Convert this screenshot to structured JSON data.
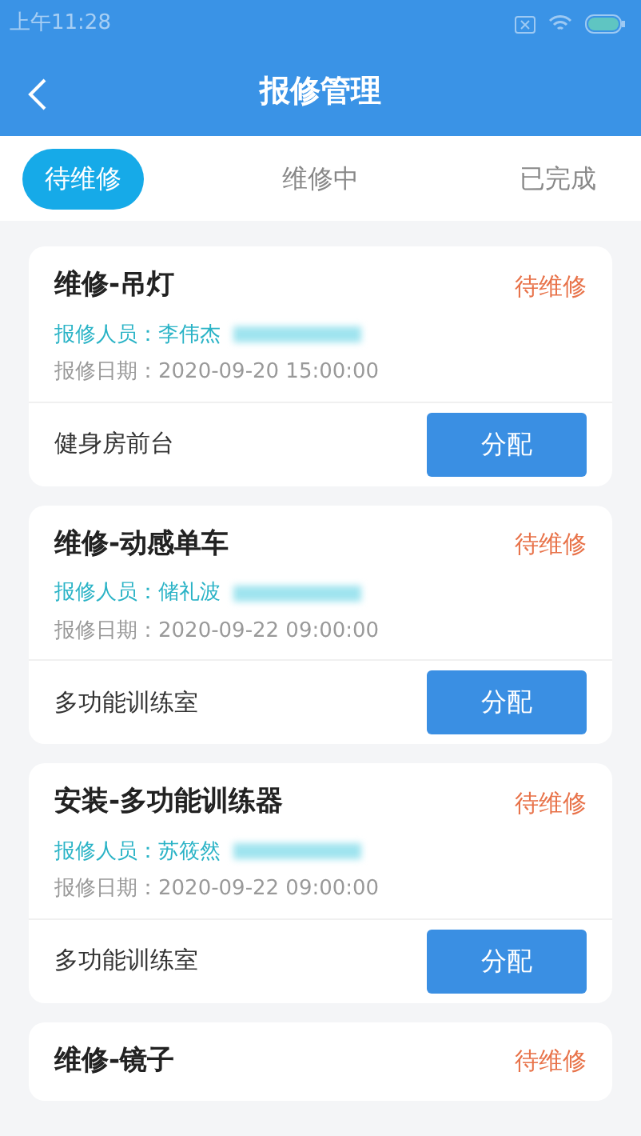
{
  "status_bar": {
    "time": "上午11:28"
  },
  "header": {
    "title": "报修管理"
  },
  "tabs": [
    {
      "label": "待维修",
      "selected": true
    },
    {
      "label": "维修中",
      "selected": false
    },
    {
      "label": "已完成",
      "selected": false
    }
  ],
  "orders": [
    {
      "title": "维修-吊灯",
      "status": "待维修",
      "reporter": "报修人员：李伟杰",
      "date": "报修日期：2020-09-20 15:00:00",
      "location": "健身房前台",
      "action": "分配"
    },
    {
      "title": "维修-动感单车",
      "status": "待维修",
      "reporter": "报修人员：储礼波",
      "date": "报修日期：2020-09-22 09:00:00",
      "location": "多功能训练室",
      "action": "分配"
    },
    {
      "title": "安装-多功能训练器",
      "status": "待维修",
      "reporter": "报修人员：苏筱然",
      "date": "报修日期：2020-09-22 09:00:00",
      "location": "多功能训练室",
      "action": "分配"
    },
    {
      "title": "维修-镜子",
      "status": "待维修"
    }
  ]
}
